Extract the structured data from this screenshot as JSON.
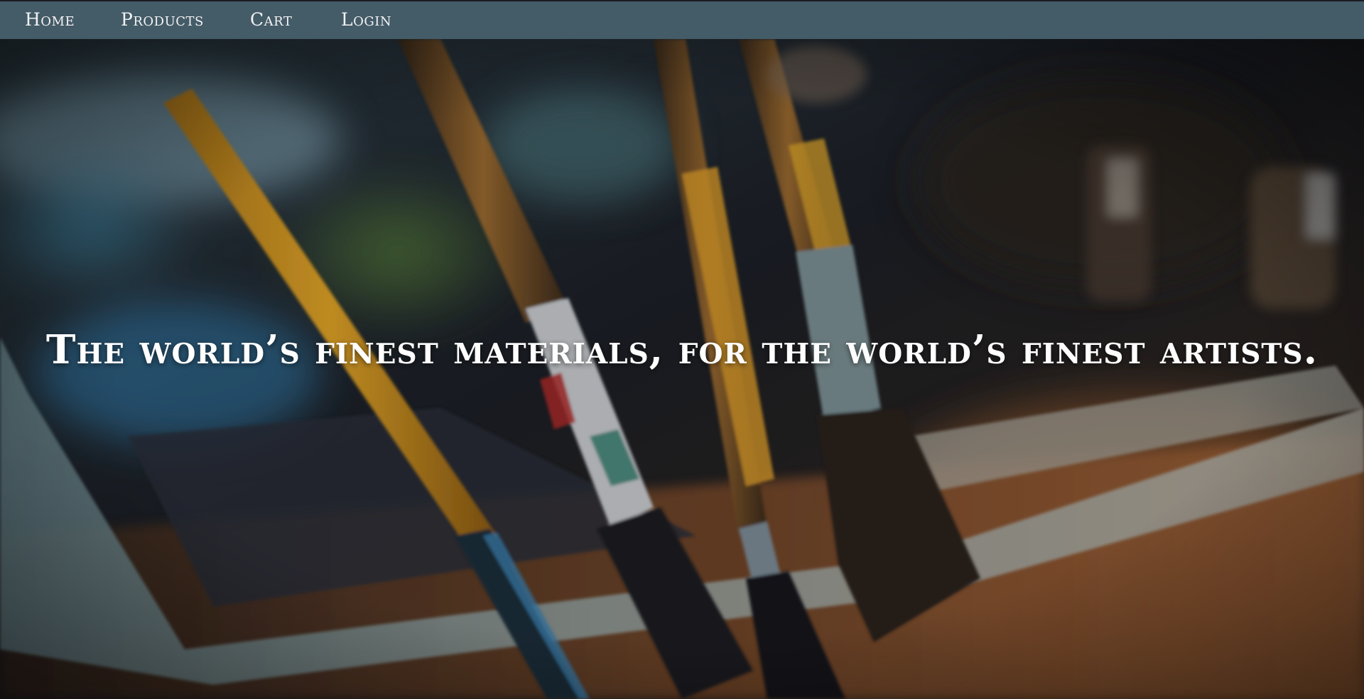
{
  "nav": {
    "items": [
      {
        "label": "Home"
      },
      {
        "label": "Products"
      },
      {
        "label": "Cart"
      },
      {
        "label": "Login"
      }
    ]
  },
  "hero": {
    "tagline": "The world’s finest materials, for the world’s finest artists.",
    "image": "paintbrushes-on-palette-photo"
  },
  "colors": {
    "nav_background": "#445b68",
    "nav_text": "#f2f2f2",
    "tagline_text": "#ffffff"
  }
}
